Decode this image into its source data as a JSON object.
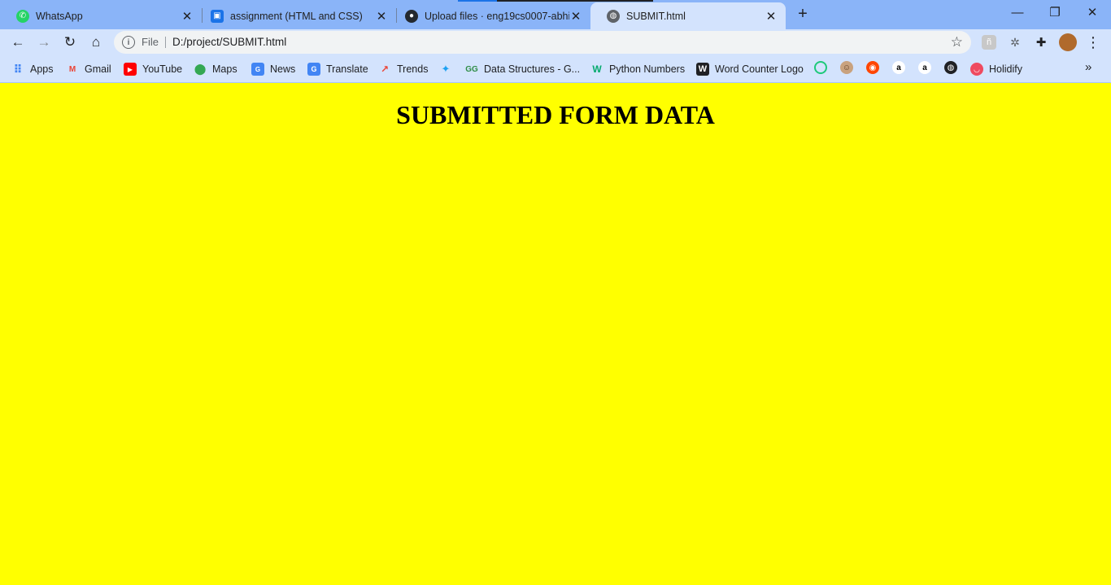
{
  "browser": {
    "tabs": [
      {
        "title": "WhatsApp",
        "icon": "whatsapp-icon"
      },
      {
        "title": "assignment (HTML and CSS)",
        "icon": "classroom-icon"
      },
      {
        "title": "Upload files · eng19cs0007-abhi/",
        "icon": "github-icon"
      },
      {
        "title": "SUBMIT.html",
        "icon": "globe-icon",
        "active": true
      }
    ],
    "window_controls": {
      "minimize": "—",
      "restore": "❐",
      "close": "✕"
    }
  },
  "toolbar": {
    "omnibox": {
      "chip": "File",
      "url": "D:/project/SUBMIT.html"
    }
  },
  "bookmarks": [
    {
      "label": "Apps",
      "icon": "apps-grid-icon"
    },
    {
      "label": "Gmail",
      "icon": "gmail-icon"
    },
    {
      "label": "YouTube",
      "icon": "youtube-icon"
    },
    {
      "label": "Maps",
      "icon": "maps-icon"
    },
    {
      "label": "News",
      "icon": "news-icon"
    },
    {
      "label": "Translate",
      "icon": "translate-icon"
    },
    {
      "label": "Trends",
      "icon": "trends-icon"
    },
    {
      "label": "",
      "icon": "twitter-icon"
    },
    {
      "label": "Data Structures - G...",
      "icon": "geeksforgeeks-icon"
    },
    {
      "label": "Python Numbers",
      "icon": "w3schools-icon"
    },
    {
      "label": "Word Counter Logo",
      "icon": "wordcounter-icon"
    },
    {
      "label": "Holidify",
      "icon": "holidify-icon"
    }
  ],
  "page": {
    "heading": "SUBMITTED FORM DATA",
    "background": "#ffff00"
  },
  "colors": {
    "tabstrip": "#8ab4f8",
    "toolbar": "#d3e3fd",
    "omnibox": "#f1f3f4"
  }
}
